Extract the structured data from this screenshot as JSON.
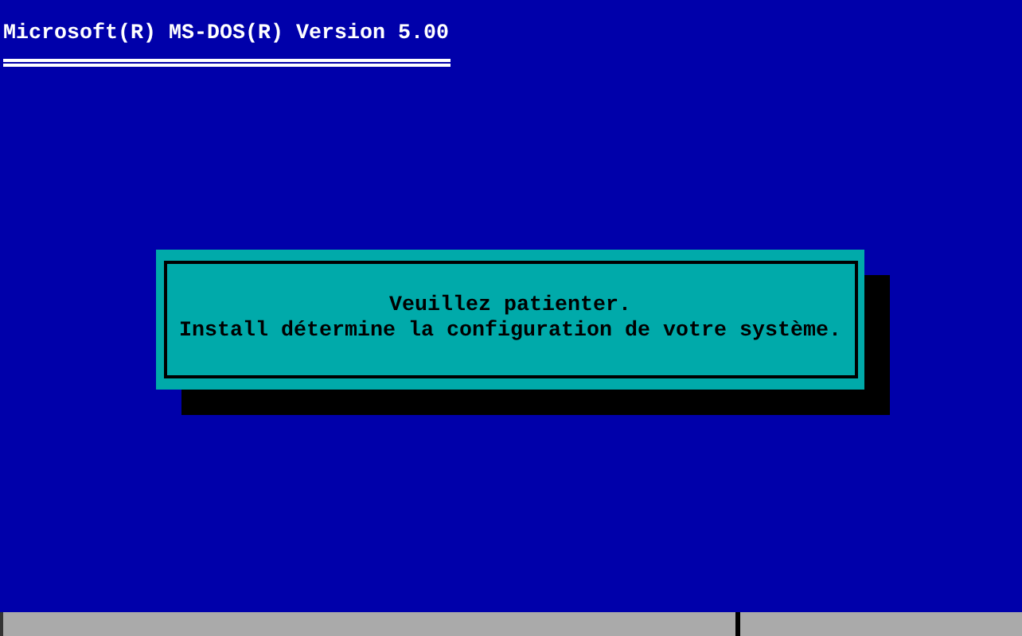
{
  "header": {
    "title": "Microsoft(R) MS-DOS(R) Version 5.00"
  },
  "dialog": {
    "lines": [
      "Veuillez patienter.",
      "Install détermine la configuration de votre système."
    ]
  }
}
